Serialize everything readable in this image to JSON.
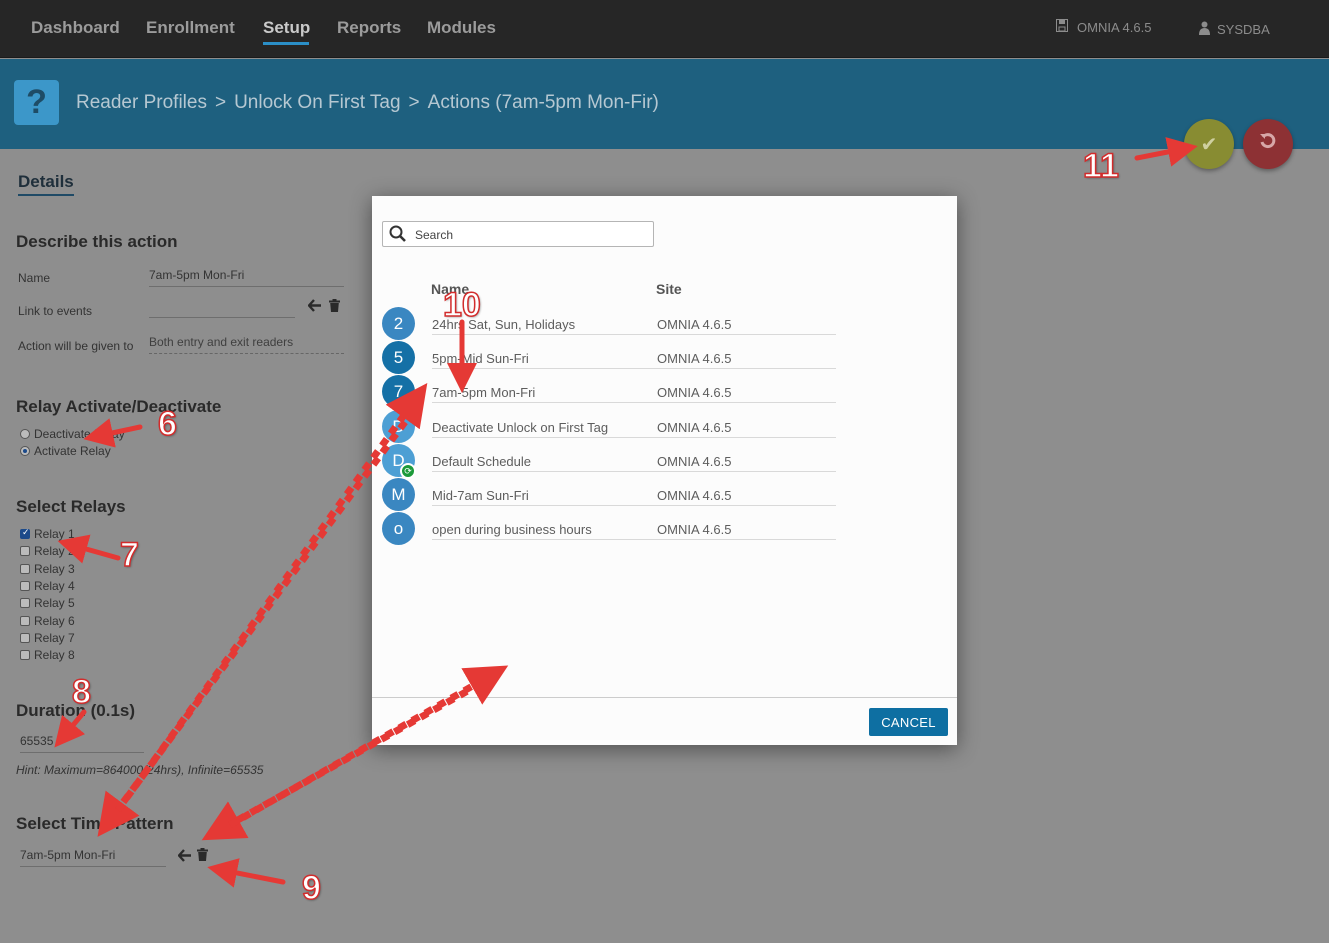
{
  "nav": {
    "items": [
      "Dashboard",
      "Enrollment",
      "Setup",
      "Reports",
      "Modules"
    ],
    "active": "Setup",
    "version": "OMNIA 4.6.5",
    "user": "SYSDBA"
  },
  "header": {
    "crumbs": [
      "Reader Profiles",
      "Unlock On First Tag",
      "Actions (7am-5pm Mon-Fir)"
    ],
    "sep": ">"
  },
  "form": {
    "tab": "Details",
    "describe_title": "Describe this action",
    "name_label": "Name",
    "name_value": "7am-5pm Mon-Fri",
    "link_label": "Link to events",
    "given_label": "Action will be given to",
    "given_value": "Both entry and exit readers",
    "relay_title": "Relay Activate/Deactivate",
    "radio_deactivate": "Deactivate Relay",
    "radio_activate": "Activate Relay",
    "select_relays_title": "Select Relays",
    "relays": [
      "Relay 1",
      "Relay 2",
      "Relay 3",
      "Relay 4",
      "Relay 5",
      "Relay 6",
      "Relay 7",
      "Relay 8"
    ],
    "duration_title": "Duration (0.1s)",
    "duration_value": "65535",
    "hint": "Hint: Maximum=864000(24hrs), Infinite=65535",
    "time_pattern_title": "Select Time Pattern",
    "time_pattern_value": "7am-5pm Mon-Fri"
  },
  "modal": {
    "search_placeholder": "Search",
    "col_name": "Name",
    "col_site": "Site",
    "rows": [
      {
        "initial": "2",
        "name": "24hrs Sat, Sun, Holidays",
        "site": "OMNIA 4.6.5",
        "color": "#3a87c1"
      },
      {
        "initial": "5",
        "name": "5pm-Mid Sun-Fri",
        "site": "OMNIA 4.6.5",
        "color": "#1570a6"
      },
      {
        "initial": "7",
        "name": "7am-5pm Mon-Fri",
        "site": "OMNIA 4.6.5",
        "color": "#1570a6"
      },
      {
        "initial": "D",
        "name": "Deactivate Unlock on First Tag",
        "site": "OMNIA 4.6.5",
        "color": "#4d9fd4"
      },
      {
        "initial": "D",
        "name": "Default Schedule",
        "site": "OMNIA 4.6.5",
        "color": "#4d9fd4"
      },
      {
        "initial": "M",
        "name": "Mid-7am Sun-Fri",
        "site": "OMNIA 4.6.5",
        "color": "#3a87c1"
      },
      {
        "initial": "o",
        "name": "open during business hours",
        "site": "OMNIA 4.6.5",
        "color": "#3a87c1"
      }
    ],
    "cancel_label": "CANCEL"
  },
  "annotations": [
    "6",
    "7",
    "8",
    "9",
    "10",
    "11"
  ],
  "colors": {
    "annotation_red": "#e53935",
    "header_blue": "#1e607f",
    "primary_button": "#0e6fa2"
  }
}
